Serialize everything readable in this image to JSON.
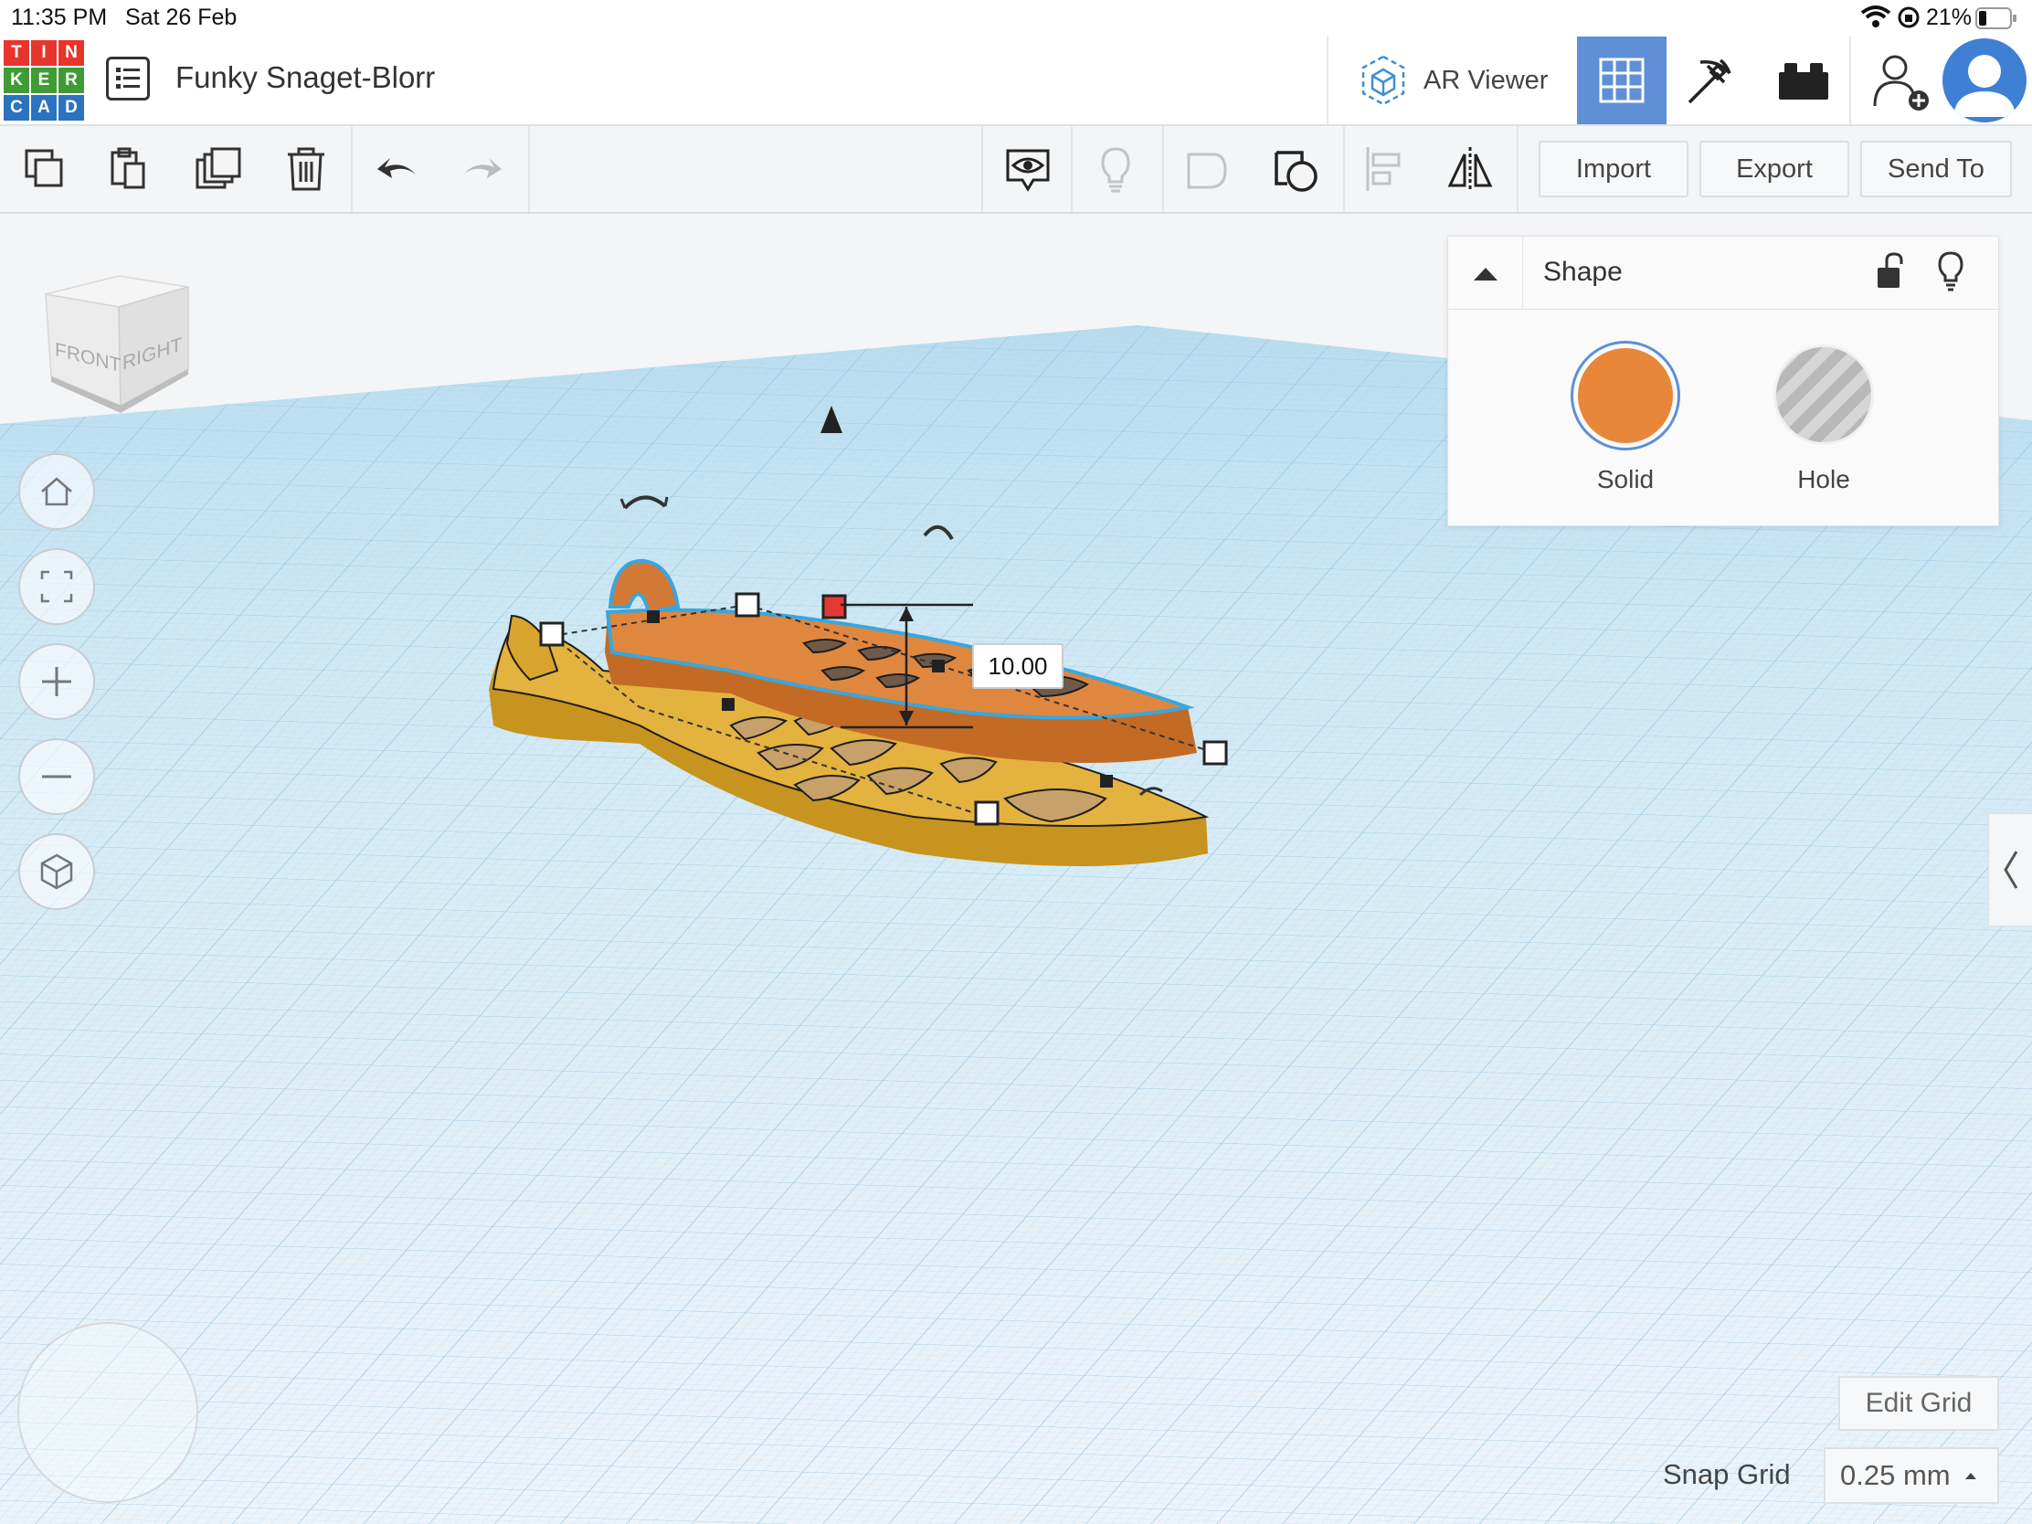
{
  "status": {
    "time": "11:35 PM",
    "date": "Sat 26 Feb",
    "battery": "21%"
  },
  "app": {
    "logo_letters": [
      "T",
      "I",
      "N",
      "K",
      "E",
      "R",
      "C",
      "A",
      "D"
    ],
    "logo_colors": [
      "#e8352b",
      "#e8352b",
      "#e8352b",
      "#3f9c35",
      "#3f9c35",
      "#3f9c35",
      "#2b72c1",
      "#2b72c1",
      "#2b72c1"
    ],
    "project_title": "Funky Snaget-Blorr"
  },
  "topbar": {
    "ar_viewer_label": "AR Viewer",
    "active_view": "3d-design-grid",
    "accent": "#5f8fd6"
  },
  "toolbar": {
    "import_label": "Import",
    "export_label": "Export",
    "send_to_label": "Send To"
  },
  "viewcube": {
    "front_label": "FRONT",
    "right_label": "RIGHT"
  },
  "dimension": {
    "value": "10.00"
  },
  "shape_panel": {
    "title": "Shape",
    "solid_label": "Solid",
    "hole_label": "Hole",
    "solid_color": "#e8873a",
    "selected": "Solid"
  },
  "grid": {
    "edit_label": "Edit Grid",
    "snap_label": "Snap Grid",
    "snap_value": "0.25 mm"
  },
  "colors": {
    "workplane": "#cfe6f3",
    "orange_shape": "#e0873f",
    "yellow_shape": "#e1b13a",
    "selection": "#3aa6dd"
  }
}
